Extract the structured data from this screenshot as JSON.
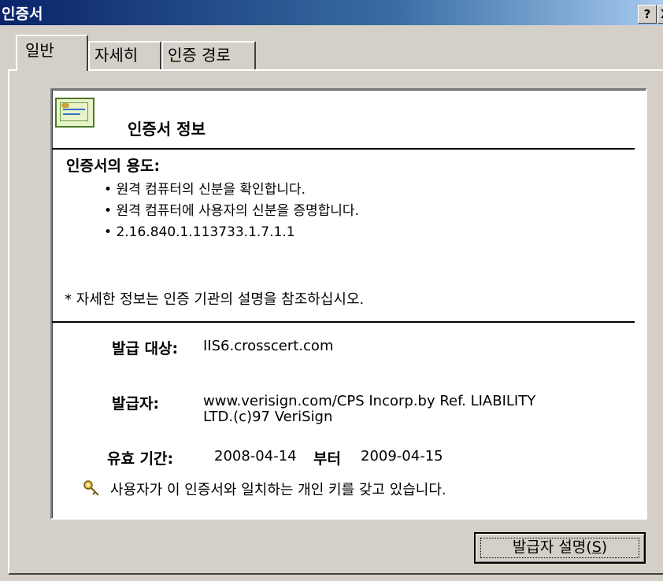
{
  "window": {
    "title": "인증서",
    "help_label": "?",
    "close_label": "X"
  },
  "tabs": [
    "일반",
    "자세히",
    "인증 경로"
  ],
  "info": {
    "heading": "인증서 정보",
    "purpose_title": "인증서의 용도:",
    "purposes": [
      "원격 컴퓨터의 신분을 확인합니다.",
      "원격 컴퓨터에 사용자의 신분을 증명합니다.",
      "2.16.840.1.113733.1.7.1.1"
    ],
    "note": "* 자세한 정보는 인증 기관의 설명을 참조하십시오.",
    "issued_to_label": "발급 대상:",
    "issued_to": "IIS6.crosscert.com",
    "issued_by_label": "발급자:",
    "issued_by_line1": "www.verisign.com/CPS Incorp.by Ref. LIABILITY",
    "issued_by_line2": "LTD.(c)97 VeriSign",
    "validity_label": "유효 기간:",
    "valid_from": "2008-04-14",
    "validity_mid": "부터",
    "valid_to": "2009-04-15",
    "key_note": "사용자가 이 인증서와 일치하는 개인 키를 갖고 있습니다."
  },
  "buttons": {
    "issuer_statement_prefix": "발급자 설명(",
    "issuer_statement_key": "S",
    "issuer_statement_suffix": ")"
  },
  "icons": {
    "certificate": "certificate-icon",
    "key": "key-icon"
  }
}
